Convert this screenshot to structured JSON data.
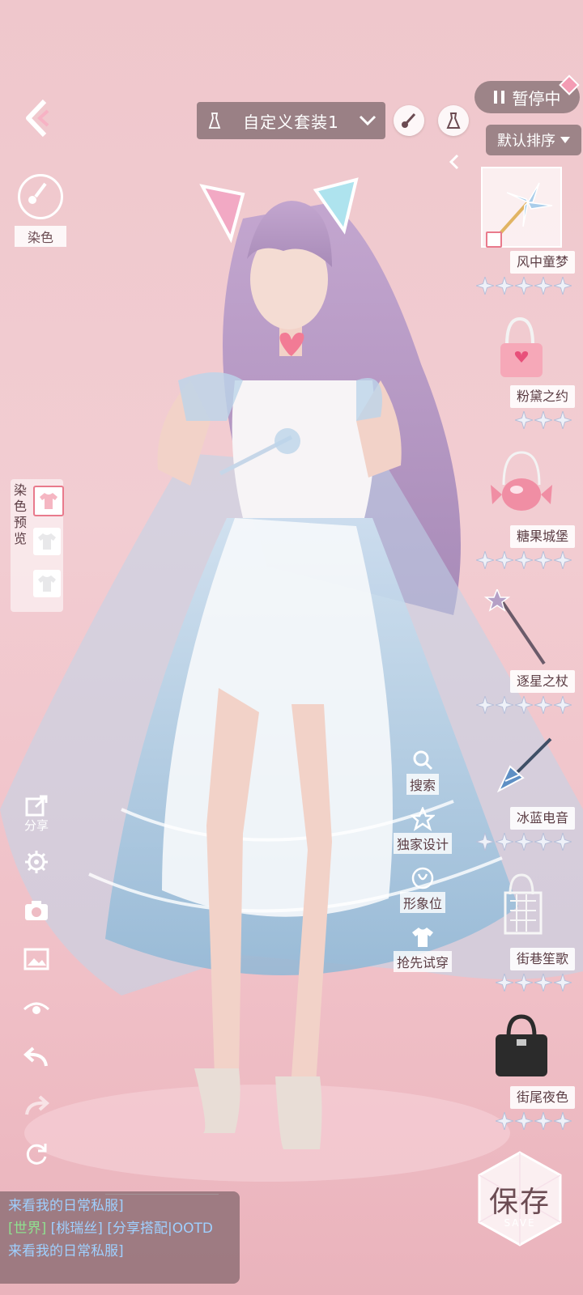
{
  "top_bar": {
    "outfit_name": "自定义套装1",
    "pause_label": "暂停中",
    "sort_label": "默认排序"
  },
  "left_panel": {
    "dye_label": "染色",
    "dye_preview_title": "染色预览",
    "share_label": "分享"
  },
  "items": [
    {
      "name": "风中童梦",
      "stars": 5,
      "selected": true
    },
    {
      "name": "粉黛之约",
      "stars": 3
    },
    {
      "name": "糖果城堡",
      "stars": 5
    },
    {
      "name": "逐星之杖",
      "stars": 5
    },
    {
      "name": "冰蓝电音",
      "stars": 5
    },
    {
      "name": "街巷笙歌",
      "stars": 4
    },
    {
      "name": "街尾夜色",
      "stars": 4
    }
  ],
  "actions": {
    "search": "搜索",
    "exclusive": "独家设计",
    "image_slot": "形象位",
    "preview_try": "抢先试穿"
  },
  "save": {
    "label": "保存",
    "sub": "SAVE"
  },
  "chat": {
    "line1": "来看我的日常私服]",
    "channel": "[世界]",
    "user": "[桃瑞丝]",
    "line2_msg": "[分享搭配|OOTD",
    "line3": "来看我的日常私服]"
  }
}
